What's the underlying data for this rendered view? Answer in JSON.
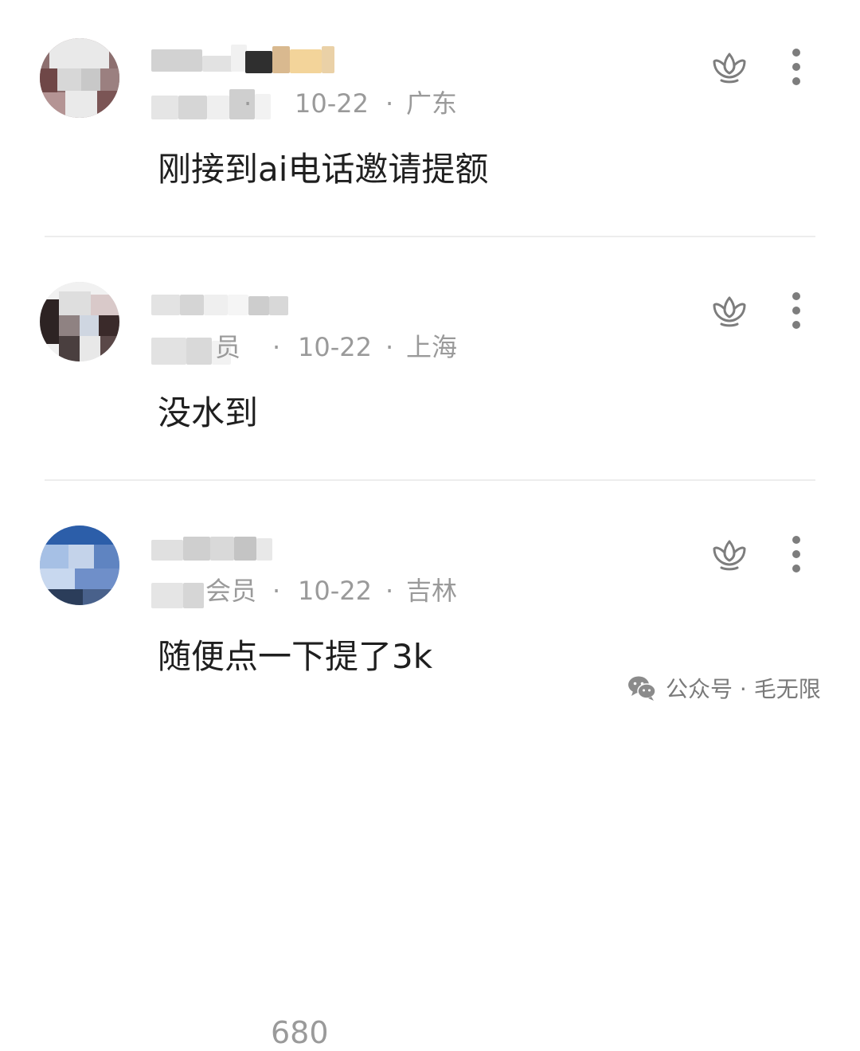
{
  "comments": [
    {
      "meta_left": "·",
      "date": "10-22",
      "separator": "·",
      "location": "广东",
      "text": "刚接到ai电话邀请提额",
      "icon_like": "lotus-like-icon",
      "icon_more": "more-vertical-icon"
    },
    {
      "meta_left": "员",
      "date": "10-22",
      "separator": "·",
      "location": "上海",
      "text": "没水到",
      "icon_like": "lotus-like-icon",
      "icon_more": "more-vertical-icon"
    },
    {
      "name_tail": "680",
      "meta_left": "会员",
      "date": "10-22",
      "separator": "·",
      "location": "吉林",
      "text": "随便点一下提了3k",
      "icon_like": "lotus-like-icon",
      "icon_more": "more-vertical-icon"
    }
  ],
  "watermark": {
    "text": "公众号 · 毛无限",
    "icon": "wechat-icon"
  },
  "colors": {
    "text": "#1f1f1f",
    "meta": "#9a9a9a",
    "divider": "#ededed",
    "watermark": "#7a7a7a"
  }
}
